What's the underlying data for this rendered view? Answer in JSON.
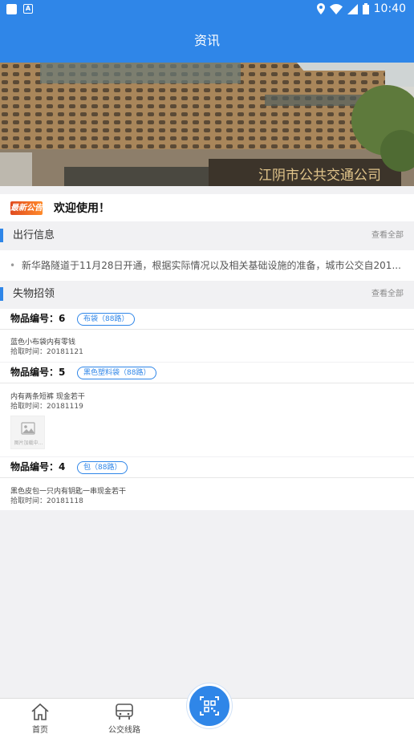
{
  "status_bar": {
    "time": "10:40"
  },
  "app_bar": {
    "title": "资讯"
  },
  "banner": {
    "sign_text": "江阴市公共交通公司"
  },
  "notice": {
    "badge": "最新公告",
    "text": "欢迎使用！"
  },
  "travel_info": {
    "title": "出行信息",
    "more": "查看全部",
    "items": [
      {
        "bullet": "•",
        "text": "新华路隧道于11月28日开通，根据实际情况以及相关基础设施的准备，城市公交自201..."
      }
    ]
  },
  "lost_found": {
    "title": "失物招领",
    "more": "查看全部",
    "items": [
      {
        "number_label": "物品编号：6",
        "tag": "布袋（88路）",
        "desc": "蓝色小布袋内有零钱",
        "time": "拾取时间：20181121"
      },
      {
        "number_label": "物品编号：5",
        "tag": "黑色塑料袋（88路）",
        "desc": "内有两条短裤 现金若干",
        "time": "拾取时间：20181119",
        "image_label": "图片加载中..."
      },
      {
        "number_label": "物品编号：4",
        "tag": "包（88路）",
        "desc": "黑色皮包一只内有钥匙一串现金若干",
        "time": "拾取时间：20181118"
      }
    ]
  },
  "tab_bar": {
    "tabs": [
      {
        "label": "首页",
        "icon": "home-icon"
      },
      {
        "label": "公交线路",
        "icon": "bus-icon"
      }
    ],
    "center_icon": "qr-scan-icon"
  },
  "colors": {
    "primary": "#2f86e8",
    "tag": "#2f86e8",
    "background": "#f1f1f3"
  }
}
